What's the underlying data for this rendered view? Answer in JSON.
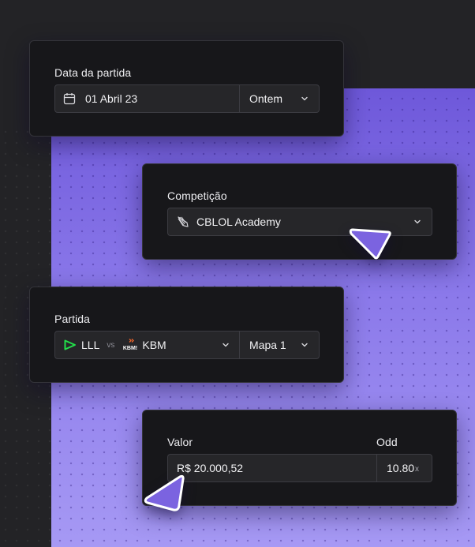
{
  "date_card": {
    "label": "Data da partida",
    "date_value": "01 Abril 23",
    "quick_option": "Ontem",
    "icons": {
      "calendar": "calendar-icon",
      "chevron": "chevron-down-icon"
    }
  },
  "competition_card": {
    "label": "Competição",
    "value": "CBLOL Academy",
    "icons": {
      "logo": "league-logo-icon",
      "chevron": "chevron-down-icon"
    }
  },
  "match_card": {
    "label": "Partida",
    "team_a": "LLL",
    "vs": "vs",
    "team_b": "KBM",
    "team_b_logo_text": "KBM!",
    "map": "Mapa 1",
    "icons": {
      "team_a_logo": "lll-logo-icon",
      "team_b_logo": "kbm-logo-icon",
      "chevron": "chevron-down-icon"
    }
  },
  "value_card": {
    "label": "Valor",
    "odd_label": "Odd",
    "amount": "R$ 20.000,52",
    "odd_value": "10.80",
    "odd_suffix": "x"
  },
  "colors": {
    "background": "#232326",
    "panel_accent": "#6E58DA",
    "card": "#17171A",
    "field": "#262629",
    "lll_green": "#22E04A",
    "kbm_orange": "#F2662A",
    "cursor": "#7B63E0"
  }
}
